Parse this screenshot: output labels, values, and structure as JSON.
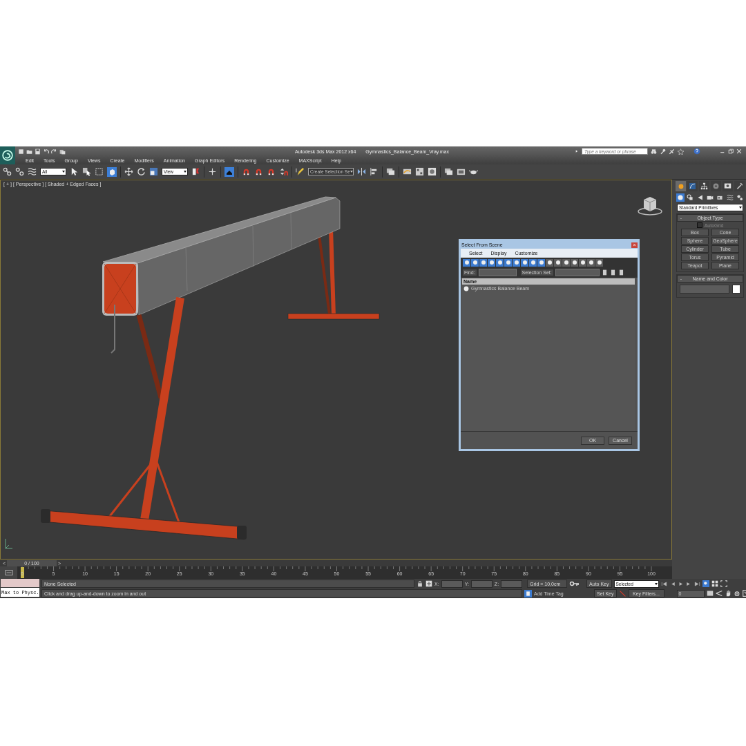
{
  "window": {
    "title": "Autodesk 3ds Max  2012 x64",
    "file": "Gymnastics_Balance_Beam_Vray.max"
  },
  "search": {
    "placeholder": "Type a keyword or phrase"
  },
  "menu": [
    "Edit",
    "Tools",
    "Group",
    "Views",
    "Create",
    "Modifiers",
    "Animation",
    "Graph Editors",
    "Rendering",
    "Customize",
    "MAXScript",
    "Help"
  ],
  "toolbar": {
    "selection_filter": "All",
    "reference_coordinate": "View",
    "named_selection": "Create Selection Se"
  },
  "viewport": {
    "labels": [
      "[ + ]",
      "[ Perspective ]",
      "[ Shaded + Edged Faces ]"
    ]
  },
  "dialog": {
    "title": "Select From Scene",
    "close": "×",
    "menu": [
      "Select",
      "Display",
      "Customize"
    ],
    "filters": [
      {
        "on": true
      },
      {
        "on": true
      },
      {
        "on": true
      },
      {
        "on": true
      },
      {
        "on": true
      },
      {
        "on": true
      },
      {
        "on": true
      },
      {
        "on": true
      },
      {
        "on": true
      },
      {
        "on": true
      },
      {
        "on": false
      },
      {
        "on": false
      },
      {
        "on": false
      },
      {
        "on": false
      },
      {
        "on": false
      },
      {
        "on": false
      },
      {
        "on": false
      }
    ],
    "find_label": "Find:",
    "selection_set_label": "Selection Set:",
    "column": "Name",
    "items": [
      {
        "name": "Gymnastics Balance Beam",
        "selected": false
      }
    ],
    "buttons": [
      "OK",
      "Cancel"
    ]
  },
  "command_panel": {
    "tabs": [
      {
        "kind": "create",
        "selected": true
      },
      {
        "kind": "modify",
        "selected": false
      },
      {
        "kind": "hierarchy",
        "selected": false
      },
      {
        "kind": "motion",
        "selected": false
      },
      {
        "kind": "display",
        "selected": false
      },
      {
        "kind": "utilities",
        "selected": false
      }
    ],
    "categories": [
      {
        "kind": "geometry",
        "selected": true
      },
      {
        "kind": "shapes",
        "selected": false
      },
      {
        "kind": "lights",
        "selected": false
      },
      {
        "kind": "cameras",
        "selected": false
      },
      {
        "kind": "helpers",
        "selected": false
      },
      {
        "kind": "space_warps",
        "selected": false
      },
      {
        "kind": "systems",
        "selected": false
      }
    ],
    "dropdown": "Standard Primitives",
    "object_type": {
      "toggle": "-",
      "title": "Object Type",
      "autogrid": {
        "label": "AutoGrid",
        "checked": false
      },
      "buttons": [
        "Box",
        "Cone",
        "Sphere",
        "GeoSphere",
        "Cylinder",
        "Tube",
        "Torus",
        "Pyramid",
        "Teapot",
        "Plane"
      ]
    },
    "name_and_color": {
      "toggle": "-",
      "title": "Name and Color"
    }
  },
  "time_slider": {
    "prev": "<",
    "position": "0 / 100",
    "next": ">",
    "level": 0
  },
  "track_bar": {
    "frames": [
      "0",
      "5",
      "10",
      "15",
      "20",
      "25",
      "30",
      "35",
      "40",
      "45",
      "50",
      "55",
      "60",
      "65",
      "70",
      "75",
      "80",
      "85",
      "90",
      "95",
      "100"
    ]
  },
  "status": {
    "listener": "Max to Physc.",
    "selection": "None Selected",
    "prompt": "Click and drag up-and-down to zoom in and out",
    "x_label": "X:",
    "y_label": "Y:",
    "z_label": "Z:",
    "grid": "Grid = 10,0cm",
    "add_time_tag": "Add Time Tag",
    "auto_key": "Auto Key",
    "key_mode": "Selected",
    "set_key": "Set Key",
    "key_filters": "Key Filters...",
    "frame": "0"
  }
}
